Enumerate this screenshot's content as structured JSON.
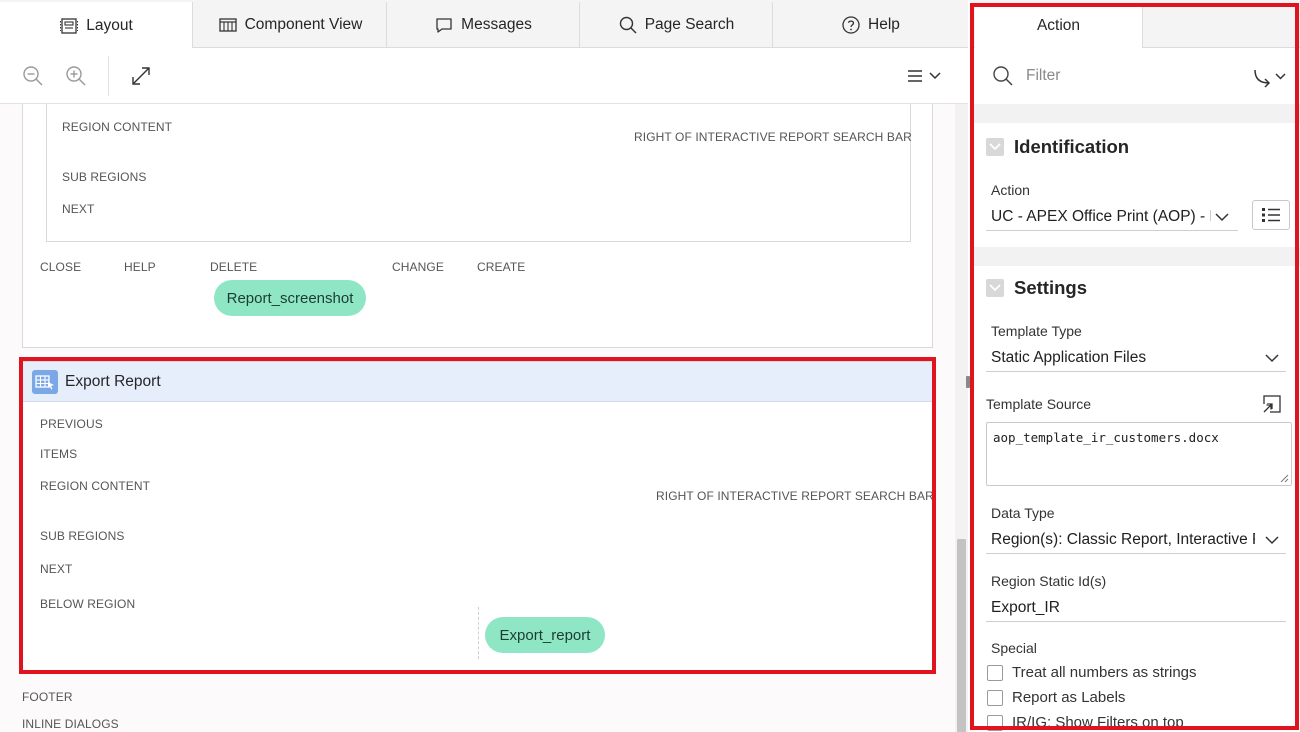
{
  "tabs": [
    {
      "label": "Layout"
    },
    {
      "label": "Component View"
    },
    {
      "label": "Messages"
    },
    {
      "label": "Page Search"
    },
    {
      "label": "Help"
    }
  ],
  "layout": {
    "upper_region": {
      "labels": {
        "region_content": "REGION CONTENT",
        "right_of_search": "RIGHT OF INTERACTIVE REPORT SEARCH BAR",
        "sub_regions": "SUB REGIONS",
        "next": "NEXT"
      },
      "buttons_row": {
        "close": "CLOSE",
        "help": "HELP",
        "delete": "DELETE",
        "change": "CHANGE",
        "create": "CREATE"
      },
      "button_pill": "Report_screenshot"
    },
    "export_region": {
      "title": "Export Report",
      "labels": {
        "previous": "PREVIOUS",
        "items": "ITEMS",
        "region_content": "REGION CONTENT",
        "right_of_search": "RIGHT OF INTERACTIVE REPORT SEARCH BAR",
        "sub_regions": "SUB REGIONS",
        "next": "NEXT",
        "below_region": "BELOW REGION"
      },
      "button_pill": "Export_report"
    },
    "footer_labels": {
      "footer": "FOOTER",
      "inline_dialogs": "INLINE DIALOGS"
    }
  },
  "property_editor": {
    "tab": "Action",
    "filter_placeholder": "Filter",
    "identification": {
      "title": "Identification",
      "action_label": "Action",
      "action_value": "UC - APEX Office Print (AOP) - D..."
    },
    "settings": {
      "title": "Settings",
      "template_type_label": "Template Type",
      "template_type_value": "Static Application Files",
      "template_source_label": "Template Source",
      "template_source_value": "aop_template_ir_customers.docx",
      "data_type_label": "Data Type",
      "data_type_value": "Region(s): Classic Report, Interactive Report",
      "region_static_label": "Region Static Id(s)",
      "region_static_value": "Export_IR",
      "special_label": "Special",
      "checkboxes": [
        {
          "label": "Treat all numbers as strings"
        },
        {
          "label": "Report as Labels"
        },
        {
          "label": "IR/IG: Show Filters on top"
        }
      ]
    }
  },
  "icons": [
    "layout-icon",
    "component-view-icon",
    "messages-icon",
    "page-search-icon",
    "help-icon",
    "zoom-out-icon",
    "zoom-in-icon",
    "expand-icon",
    "menu-icon",
    "search-icon",
    "go-to-icon",
    "collapse-icon",
    "list-icon",
    "open-dialog-icon",
    "chevron-down-icon",
    "report-region-icon"
  ],
  "colors": {
    "highlight": "#e0141e",
    "button_pill": "#8fe6c4",
    "region_header": "#e6eefb"
  }
}
